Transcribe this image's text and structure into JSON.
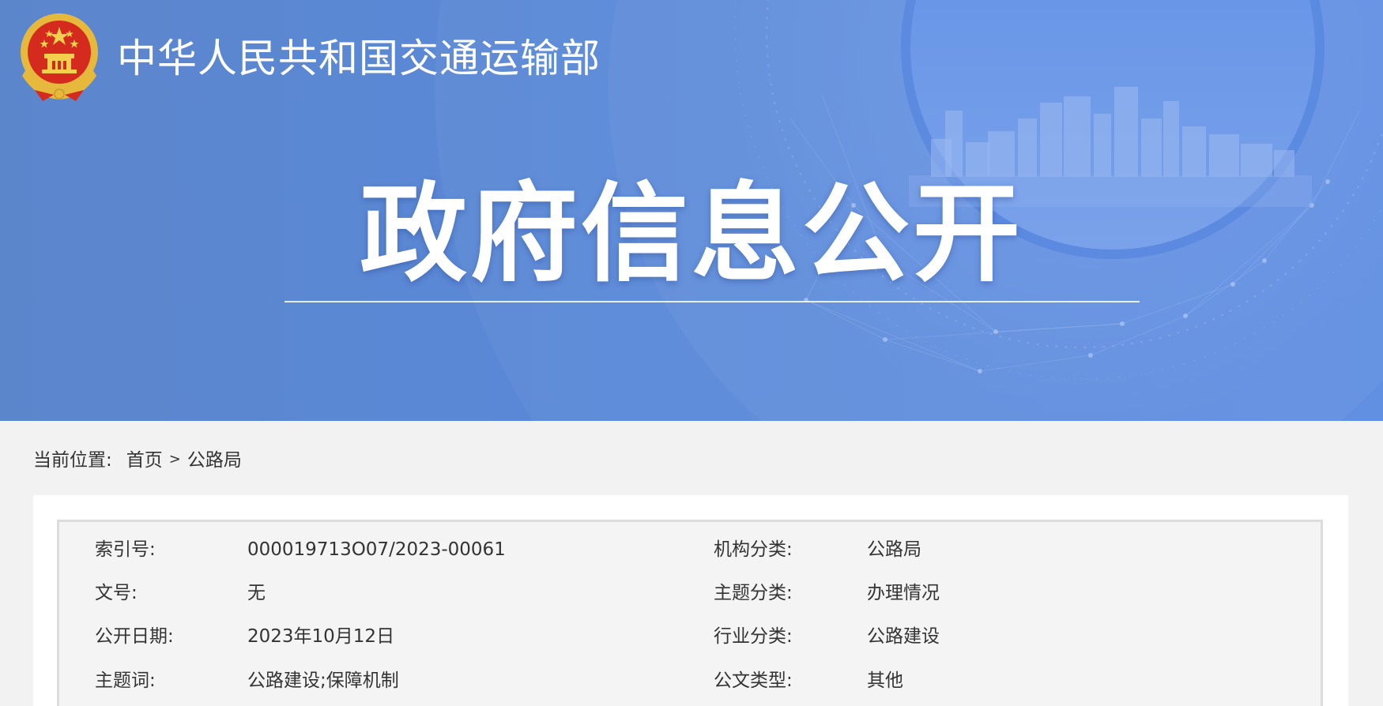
{
  "header": {
    "ministry_name": "中华人民共和国交通运输部",
    "banner_title": "政府信息公开"
  },
  "breadcrumb": {
    "label": "当前位置:",
    "home": "首页",
    "separator": ">",
    "current": "公路局"
  },
  "info_rows": [
    {
      "left_label": "索引号:",
      "left_value": "000019713O07/2023-00061",
      "right_label": "机构分类:",
      "right_value": "公路局"
    },
    {
      "left_label": "文号:",
      "left_value": "无",
      "right_label": "主题分类:",
      "right_value": "办理情况"
    },
    {
      "left_label": "公开日期:",
      "left_value": "2023年10月12日",
      "right_label": "行业分类:",
      "right_value": "公路建设"
    },
    {
      "left_label": "主题词:",
      "left_value": "公路建设;保障机制",
      "right_label": "公文类型:",
      "right_value": "其他"
    }
  ],
  "icons": {
    "emblem": "national-emblem-icon"
  },
  "colors": {
    "banner_blue": "#5b89d6",
    "page_background": "#f2f2f2",
    "info_box_background": "#f4f4f4",
    "info_box_border": "#dcdcdc"
  }
}
